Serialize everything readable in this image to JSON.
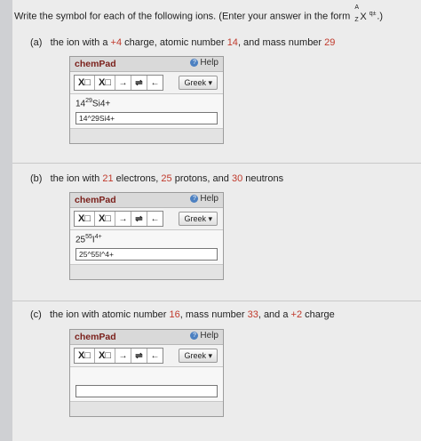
{
  "instructions": {
    "text": "Write the symbol for each of the following ions. (Enter your answer in the form",
    "form_sup": "A",
    "form_sub": "Z",
    "form_base": "X",
    "form_charge": "q±",
    "close": ".)"
  },
  "questions": [
    {
      "label": "(a)",
      "text_1": "the ion with a",
      "v1": "+4",
      "text_2": "charge, atomic number",
      "v2": "14",
      "text_3": ", and mass number",
      "v3": "29",
      "render_prefix": "14",
      "render_sup": "29",
      "render_main": "Si4+",
      "input_value": "14^29Si4+"
    },
    {
      "label": "(b)",
      "text_1": "the ion with",
      "v1": "21",
      "text_2": "electrons,",
      "v2": "25",
      "text_3": "protons, and",
      "v3": "30",
      "text_4": "neutrons",
      "render_prefix": "25",
      "render_sup": "55",
      "render_main": "I",
      "render_sup2": "4+",
      "input_value": "25^55I^4+"
    },
    {
      "label": "(c)",
      "text_1": "the ion with atomic number",
      "v1": "16",
      "text_2": ", mass number",
      "v2": "33",
      "text_3": ", and a",
      "v3": "+2",
      "text_4": "charge",
      "input_value": ""
    }
  ],
  "chempad": {
    "title": "chemPad",
    "help": "Help",
    "btn_sub": "X□",
    "btn_sup": "X□",
    "btn_arrow": "→",
    "btn_eq": "⇌",
    "btn_back": "←",
    "greek": "Greek ▾"
  }
}
